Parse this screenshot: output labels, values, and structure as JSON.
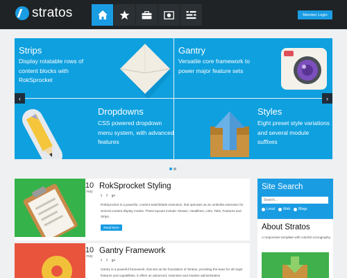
{
  "header": {
    "logo_text": "stratos",
    "nav": [
      {
        "icon": "home-icon",
        "active": true
      },
      {
        "icon": "star-icon",
        "active": false
      },
      {
        "icon": "briefcase-icon",
        "active": false
      },
      {
        "icon": "picture-icon",
        "active": false
      },
      {
        "icon": "sliders-icon",
        "active": false
      }
    ],
    "login_label": "Member Login"
  },
  "showcase": {
    "tiles": [
      {
        "title": "Strips",
        "desc": "Display rotatable rows of content blocks with RokSprocket"
      },
      {
        "title": "Gantry",
        "desc": "Versatile core framework to power major feature sets"
      },
      {
        "title": "Dropdowns",
        "desc": "CSS powered dropdown menu system, with advanced features"
      },
      {
        "title": "Styles",
        "desc": "Eight preset style variations and several module suffixes"
      }
    ],
    "prev_arrow": "‹",
    "next_arrow": "›"
  },
  "posts": [
    {
      "day": "10",
      "month": "may",
      "title": "RokSprocket Styling",
      "text": "RokSprocket is a powerful, content switchblade extension, that operates as an umbrella extension for several content display modes. These layouts include: Mosaic, Headlines, Lists, Tabs, Features and Strips.",
      "readmore": "Read More"
    },
    {
      "day": "10",
      "month": "may",
      "title": "Gantry Framework",
      "text": "Gantry is a powerful framework, that sits as the foundation of Stratos, providing the base for all major features and capabilities. It offers an advanced, extensive and intuitive administrative"
    }
  ],
  "social": {
    "twitter": "𝕥",
    "facebook": "f",
    "google": "g+"
  },
  "sidebar": {
    "search_title": "Site Search",
    "search_placeholder": "Search...",
    "options": [
      "Local",
      "Web",
      "Blogs"
    ],
    "about_title": "About Stratos",
    "about_text": "A responsive template with colorful iconography."
  },
  "colors": {
    "accent": "#1a9ce3",
    "topbar": "#1f2326",
    "tile": "#0ea0df"
  }
}
